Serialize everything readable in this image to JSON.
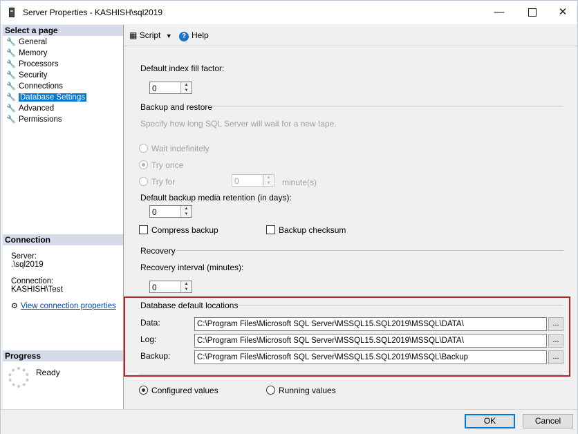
{
  "window": {
    "title": "Server Properties - KASHISH\\sql2019"
  },
  "left": {
    "select_page_header": "Select a page",
    "pages": [
      {
        "label": "General"
      },
      {
        "label": "Memory"
      },
      {
        "label": "Processors"
      },
      {
        "label": "Security"
      },
      {
        "label": "Connections"
      },
      {
        "label": "Database Settings",
        "selected": true
      },
      {
        "label": "Advanced"
      },
      {
        "label": "Permissions"
      }
    ],
    "connection_header": "Connection",
    "server_label": "Server:",
    "server_value": ".\\sql2019",
    "connection_label": "Connection:",
    "connection_value": "KASHISH\\Test",
    "view_connection_link": "View connection properties",
    "progress_header": "Progress",
    "progress_status": "Ready"
  },
  "toolbar": {
    "script_label": "Script",
    "help_label": "Help"
  },
  "settings": {
    "fill_factor_label": "Default index fill factor:",
    "fill_factor_value": "0",
    "backup_restore_header": "Backup and restore",
    "tape_hint": "Specify how long SQL Server will wait for a new tape.",
    "wait_indefinitely": "Wait indefinitely",
    "try_once": "Try once",
    "try_for": "Try for",
    "try_for_value": "0",
    "minutes_unit": "minute(s)",
    "retention_label": "Default backup media retention (in days):",
    "retention_value": "0",
    "compress_backup": "Compress backup",
    "backup_checksum": "Backup checksum",
    "recovery_header": "Recovery",
    "recovery_interval_label": "Recovery interval (minutes):",
    "recovery_interval_value": "0",
    "locations_header": "Database default locations",
    "data_label": "Data:",
    "data_path": "C:\\Program Files\\Microsoft SQL Server\\MSSQL15.SQL2019\\MSSQL\\DATA\\",
    "log_label": "Log:",
    "log_path": "C:\\Program Files\\Microsoft SQL Server\\MSSQL15.SQL2019\\MSSQL\\DATA\\",
    "backup_label": "Backup:",
    "backup_path": "C:\\Program Files\\Microsoft SQL Server\\MSSQL15.SQL2019\\MSSQL\\Backup",
    "browse_label": "...",
    "configured_values": "Configured values",
    "running_values": "Running values"
  },
  "buttons": {
    "ok": "OK",
    "cancel": "Cancel"
  },
  "colors": {
    "accent": "#0078d7",
    "highlight_border": "#b3242a",
    "section_header": "#d6dbe9"
  },
  "icons": {
    "page_icon": "wrench-icon",
    "help": "help-icon",
    "script": "script-icon"
  }
}
